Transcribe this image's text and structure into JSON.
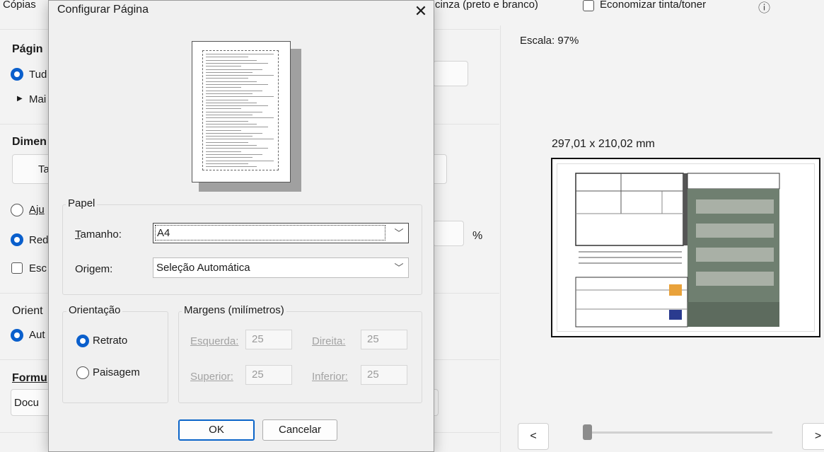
{
  "background": {
    "topbar": {
      "copies_label": "Cópias",
      "color_fragment": "cinza (preto e branco)",
      "save_ink_label": "Economizar tinta/toner",
      "info_glyph": "ⓘ"
    },
    "left": {
      "pages_heading": "Págin",
      "all_label": "Tud",
      "more_label": "Mai",
      "dimension_heading": "Dimen",
      "size_btn_fragment": "Ta",
      "adjust_label": "Aju",
      "reduce_label": "Red",
      "percent": "%",
      "scale_check_label": "Esc",
      "orientation_heading": "Orient",
      "auto_label": "Aut",
      "format_heading": "Formu",
      "format_value": "Docu"
    },
    "preview": {
      "scale_text": "Escala:  97%",
      "size_text": "297,01 x 210,02 mm",
      "prev_glyph": "<",
      "next_glyph": ">"
    }
  },
  "dialog": {
    "title": "Configurar Página",
    "close_glyph": "✕",
    "paper": {
      "legend": "Papel",
      "size_label": "Tamanho:",
      "size_value": "A4",
      "source_label": "Origem:",
      "source_value": "Seleção Automática"
    },
    "orientation": {
      "legend": "Orientação",
      "portrait": "Retrato",
      "landscape": "Paisagem",
      "selected": "portrait"
    },
    "margins": {
      "legend": "Margens (milímetros)",
      "left_label": "Esquerda:",
      "left_value": "25",
      "right_label": "Direita:",
      "right_value": "25",
      "top_label": "Superior:",
      "top_value": "25",
      "bottom_label": "Inferior:",
      "bottom_value": "25"
    },
    "ok_label": "OK",
    "cancel_label": "Cancelar"
  },
  "colors": {
    "accent": "#0a5fcc",
    "dialog_bg": "#f0f0f0"
  }
}
